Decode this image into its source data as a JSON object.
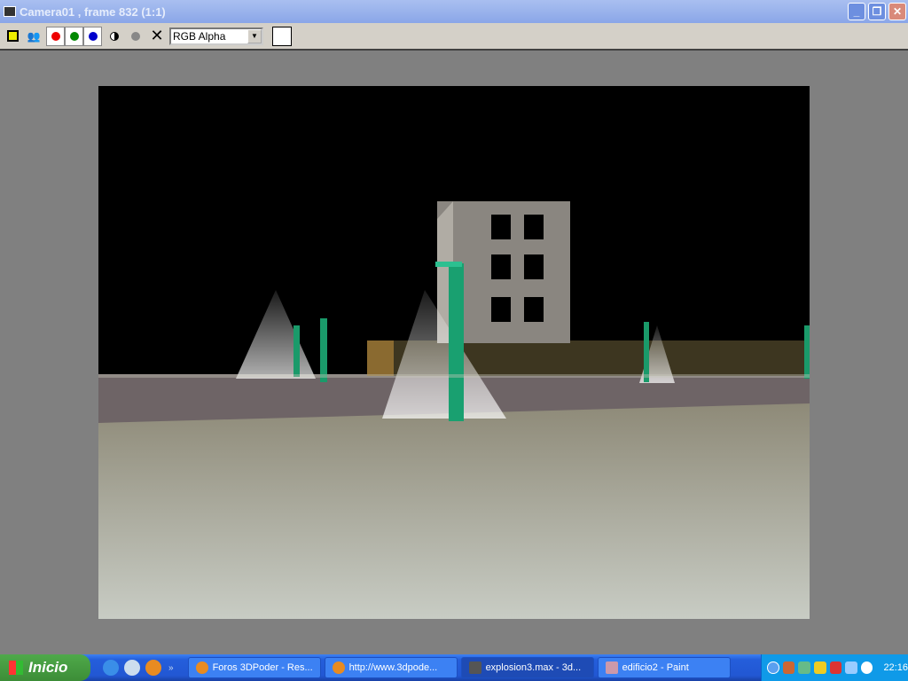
{
  "window": {
    "title": "Camera01 , frame 832 (1:1)",
    "minimize": "_",
    "restore": "❐",
    "close": "✕"
  },
  "toolbar": {
    "channel": "RGB Alpha",
    "save_icon": "save-icon",
    "clone_icon": "clone-icon",
    "clear": "✕"
  },
  "taskbar": {
    "start": "Inicio",
    "more": "»",
    "tasks": [
      {
        "label": "Foros 3DPoder - Res..."
      },
      {
        "label": "http://www.3dpode..."
      },
      {
        "label": "explosion3.max - 3d..."
      },
      {
        "label": "edificio2 - Paint"
      }
    ],
    "clock": "22:16"
  }
}
